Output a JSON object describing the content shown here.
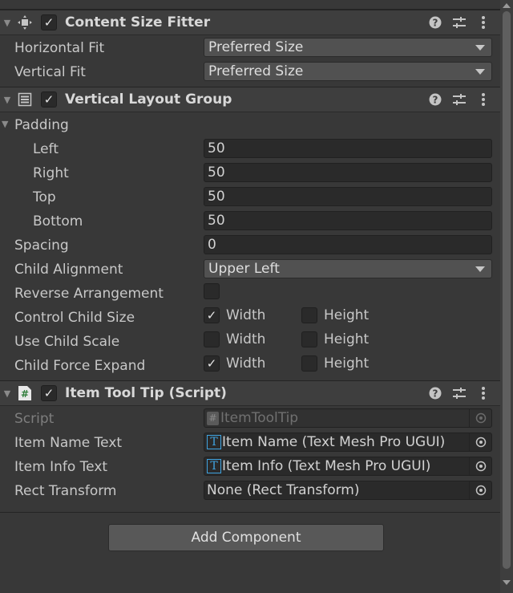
{
  "components": {
    "content_size_fitter": {
      "title": "Content Size Fitter",
      "enabled": true,
      "horizontal_fit": {
        "label": "Horizontal Fit",
        "value": "Preferred Size"
      },
      "vertical_fit": {
        "label": "Vertical Fit",
        "value": "Preferred Size"
      }
    },
    "vertical_layout_group": {
      "title": "Vertical Layout Group",
      "enabled": true,
      "padding_label": "Padding",
      "left": {
        "label": "Left",
        "value": "50"
      },
      "right": {
        "label": "Right",
        "value": "50"
      },
      "top": {
        "label": "Top",
        "value": "50"
      },
      "bottom": {
        "label": "Bottom",
        "value": "50"
      },
      "spacing": {
        "label": "Spacing",
        "value": "0"
      },
      "child_alignment": {
        "label": "Child Alignment",
        "value": "Upper Left"
      },
      "reverse_arrangement": {
        "label": "Reverse Arrangement",
        "checked": false
      },
      "control_child_size": {
        "label": "Control Child Size",
        "width_label": "Width",
        "width": true,
        "height_label": "Height",
        "height": false
      },
      "use_child_scale": {
        "label": "Use Child Scale",
        "width_label": "Width",
        "width": false,
        "height_label": "Height",
        "height": false
      },
      "child_force_expand": {
        "label": "Child Force Expand",
        "width_label": "Width",
        "width": true,
        "height_label": "Height",
        "height": false
      }
    },
    "item_tool_tip": {
      "title": "Item Tool Tip (Script)",
      "enabled": true,
      "script": {
        "label": "Script",
        "value": "ItemToolTip"
      },
      "item_name_text": {
        "label": "Item Name Text",
        "value": "Item Name (Text Mesh Pro UGUI)"
      },
      "item_info_text": {
        "label": "Item Info Text",
        "value": "Item Info (Text Mesh Pro UGUI)"
      },
      "rect_transform": {
        "label": "Rect Transform",
        "value": "None (Rect Transform)"
      }
    }
  },
  "add_component_label": "Add Component",
  "icons": {
    "help": "help-icon",
    "presets": "presets-icon",
    "menu": "kebab-menu-icon",
    "check": "✓"
  },
  "colors": {
    "background": "#383838",
    "header": "#3e3e3e",
    "field": "#2a2a2a",
    "dropdown": "#515151",
    "tmp_accent": "#3fa3e0"
  }
}
